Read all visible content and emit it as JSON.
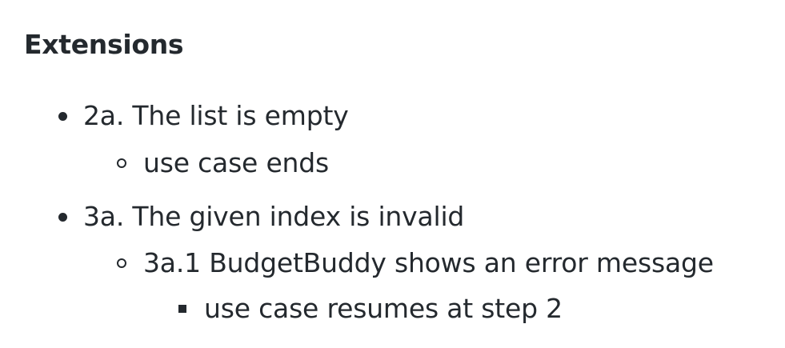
{
  "section": {
    "heading": "Extensions"
  },
  "items": [
    {
      "label": "2a. The list is empty",
      "children": [
        {
          "label": "use case ends"
        }
      ]
    },
    {
      "label": "3a. The given index is invalid",
      "children": [
        {
          "label": "3a.1 BudgetBuddy shows an error message",
          "children": [
            {
              "label": "use case resumes at step 2"
            }
          ]
        }
      ]
    }
  ]
}
